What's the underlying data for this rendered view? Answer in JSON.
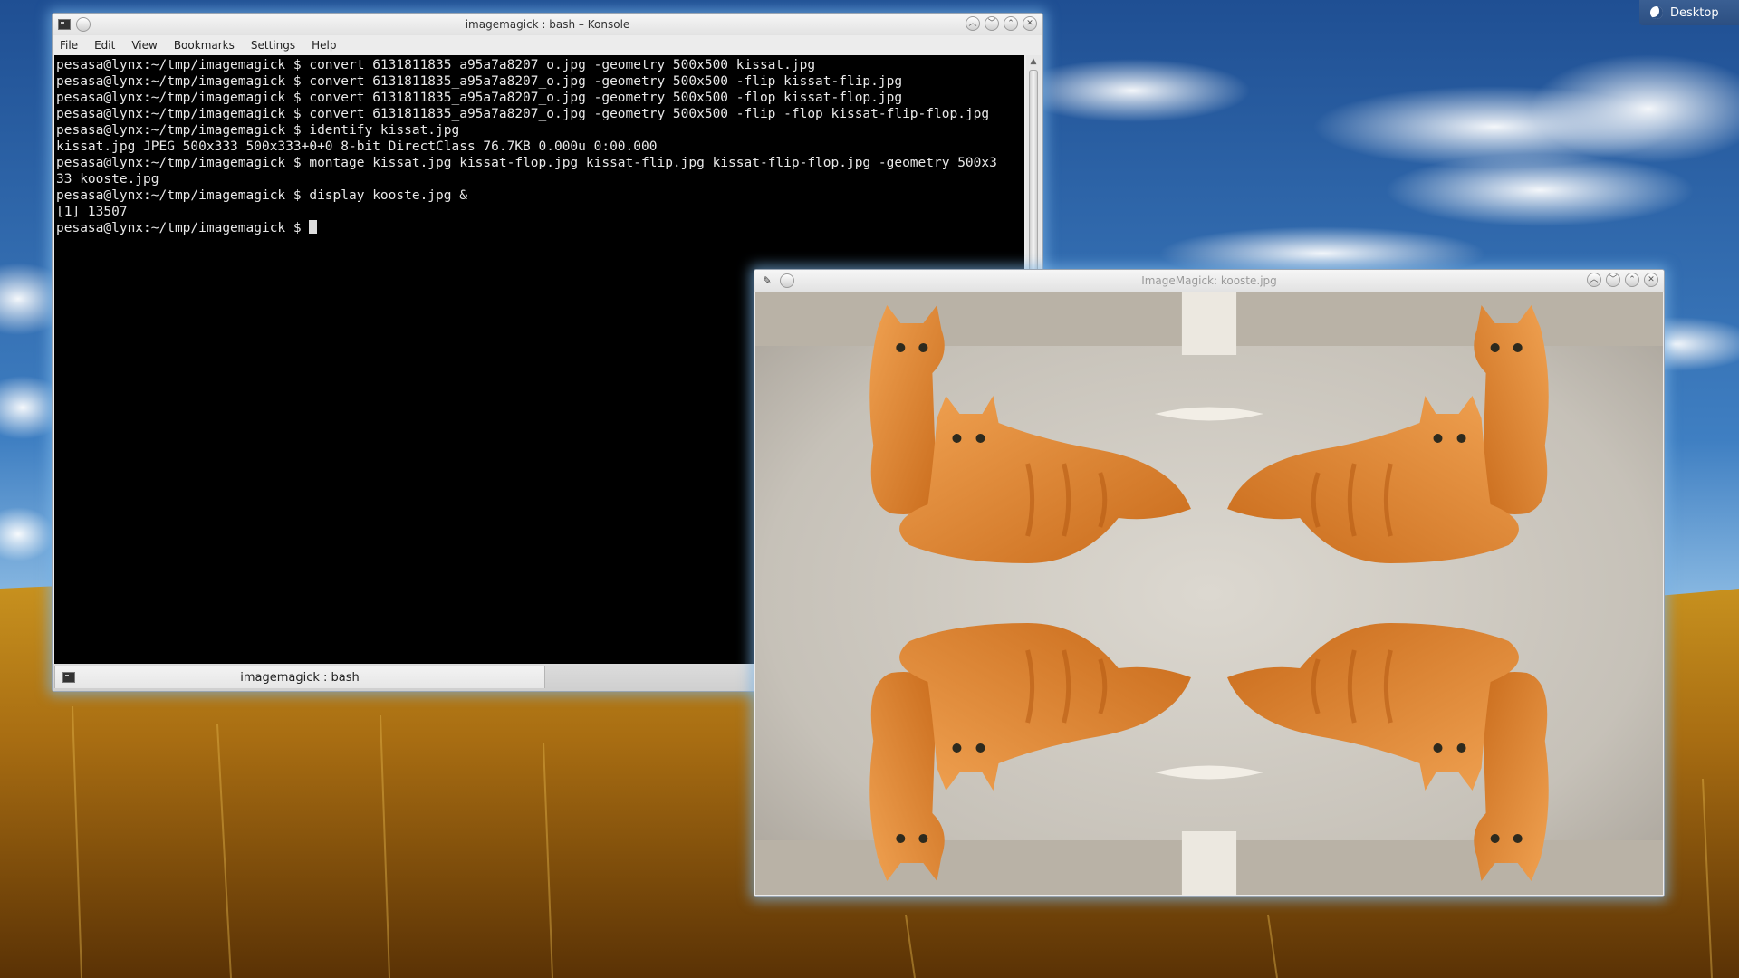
{
  "desktop_button": {
    "label": "Desktop",
    "icon": "moon-icon"
  },
  "konsole": {
    "title": "imagemagick : bash – Konsole",
    "menu": [
      "File",
      "Edit",
      "View",
      "Bookmarks",
      "Settings",
      "Help"
    ],
    "terminal_lines": [
      "pesasa@lynx:~/tmp/imagemagick $ convert 6131811835_a95a7a8207_o.jpg -geometry 500x500 kissat.jpg",
      "pesasa@lynx:~/tmp/imagemagick $ convert 6131811835_a95a7a8207_o.jpg -geometry 500x500 -flip kissat-flip.jpg",
      "pesasa@lynx:~/tmp/imagemagick $ convert 6131811835_a95a7a8207_o.jpg -geometry 500x500 -flop kissat-flop.jpg",
      "pesasa@lynx:~/tmp/imagemagick $ convert 6131811835_a95a7a8207_o.jpg -geometry 500x500 -flip -flop kissat-flip-flop.jpg",
      "pesasa@lynx:~/tmp/imagemagick $ identify kissat.jpg",
      "kissat.jpg JPEG 500x333 500x333+0+0 8-bit DirectClass 76.7KB 0.000u 0:00.000",
      "pesasa@lynx:~/tmp/imagemagick $ montage kissat.jpg kissat-flop.jpg kissat-flip.jpg kissat-flip-flop.jpg -geometry 500x3",
      "33 kooste.jpg",
      "pesasa@lynx:~/tmp/imagemagick $ display kooste.jpg &",
      "[1] 13507"
    ],
    "prompt": "pesasa@lynx:~/tmp/imagemagick $ ",
    "tab_label": "imagemagick : bash"
  },
  "display_window": {
    "title": "ImageMagick: kooste.jpg"
  }
}
